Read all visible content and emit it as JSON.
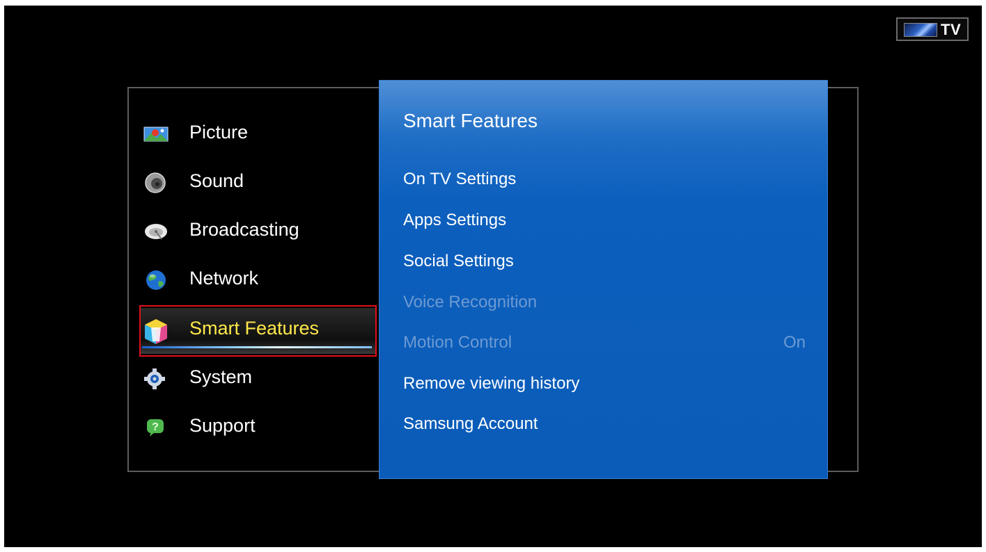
{
  "badge": {
    "label": "TV",
    "icon": "tv-screen-icon"
  },
  "main_menu": {
    "items": [
      {
        "label": "Picture",
        "icon": "picture-icon",
        "selected": false
      },
      {
        "label": "Sound",
        "icon": "speaker-icon",
        "selected": false
      },
      {
        "label": "Broadcasting",
        "icon": "satellite-dish-icon",
        "selected": false
      },
      {
        "label": "Network",
        "icon": "globe-icon",
        "selected": false
      },
      {
        "label": "Smart Features",
        "icon": "smart-hub-cube-icon",
        "selected": true
      },
      {
        "label": "System",
        "icon": "gear-icon",
        "selected": false
      },
      {
        "label": "Support",
        "icon": "help-bubble-icon",
        "selected": false
      }
    ]
  },
  "submenu": {
    "title": "Smart Features",
    "items": [
      {
        "label": "On TV Settings",
        "value": "",
        "enabled": true
      },
      {
        "label": "Apps Settings",
        "value": "",
        "enabled": true
      },
      {
        "label": "Social Settings",
        "value": "",
        "enabled": true
      },
      {
        "label": "Voice Recognition",
        "value": "",
        "enabled": false
      },
      {
        "label": "Motion Control",
        "value": "On",
        "enabled": false
      },
      {
        "label": "Remove viewing history",
        "value": "",
        "enabled": true
      },
      {
        "label": "Samsung Account",
        "value": "",
        "enabled": true
      }
    ]
  },
  "colors": {
    "background": "#000000",
    "panel_blue": "#0b5cb8",
    "selected_text": "#ffe84a",
    "disabled_text": "#6d9ad3",
    "selection_outline": "#e0101b"
  }
}
